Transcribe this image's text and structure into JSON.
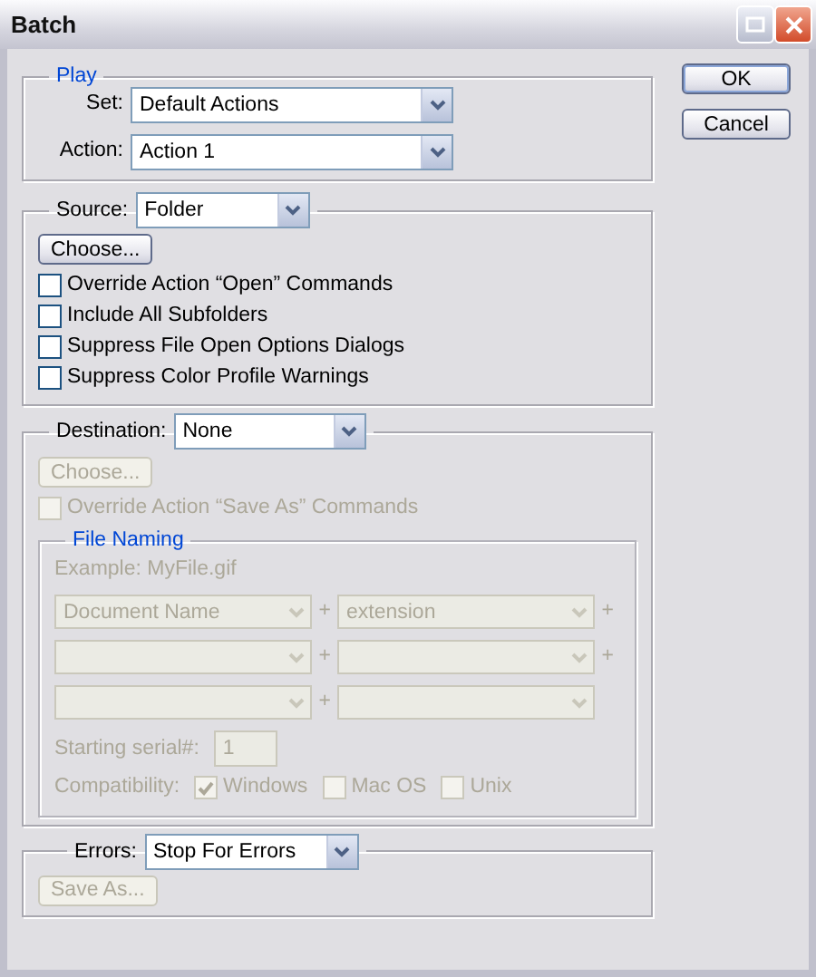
{
  "window": {
    "title": "Batch"
  },
  "play": {
    "legend": "Play",
    "fields": [
      {
        "label": "Set:",
        "value": "Default Actions"
      },
      {
        "label": "Action:",
        "value": "Action 1"
      }
    ]
  },
  "source": {
    "label": "Source:",
    "value": "Folder",
    "choose": {
      "label": "Choose...",
      "disabled": false
    },
    "options": [
      {
        "label": "Override Action “Open” Commands",
        "checked": false,
        "disabled": false
      },
      {
        "label": "Include All Subfolders",
        "checked": false,
        "disabled": false
      },
      {
        "label": "Suppress File Open Options Dialogs",
        "checked": false,
        "disabled": false
      },
      {
        "label": "Suppress Color Profile Warnings",
        "checked": false,
        "disabled": false
      }
    ]
  },
  "destination": {
    "label": "Destination:",
    "value": "None",
    "choose": {
      "label": "Choose...",
      "disabled": true
    },
    "override": {
      "label": "Override Action “Save As” Commands",
      "checked": false,
      "disabled": true
    },
    "file_naming": {
      "legend": "File Naming",
      "disabled": true,
      "example": "Example: MyFile.gif",
      "rows": [
        [
          {
            "value": "Document Name",
            "suffix": "+"
          },
          {
            "value": "extension",
            "suffix": "+"
          }
        ],
        [
          {
            "suffix": "+"
          },
          {
            "suffix": "+"
          }
        ],
        [
          {
            "suffix": "+"
          },
          {}
        ]
      ],
      "serial": {
        "label": "Starting serial#:",
        "value": "1"
      },
      "compatibility": {
        "label": "Compatibility:",
        "options": [
          {
            "label": "Windows",
            "checked": true
          },
          {
            "label": "Mac OS",
            "checked": false
          },
          {
            "label": "Unix",
            "checked": false
          }
        ]
      }
    }
  },
  "errors": {
    "label": "Errors:",
    "value": "Stop For Errors",
    "save_as": {
      "label": "Save As...",
      "disabled": true
    }
  },
  "buttons": [
    {
      "label": "OK",
      "default": true
    },
    {
      "label": "Cancel",
      "default": false
    }
  ]
}
